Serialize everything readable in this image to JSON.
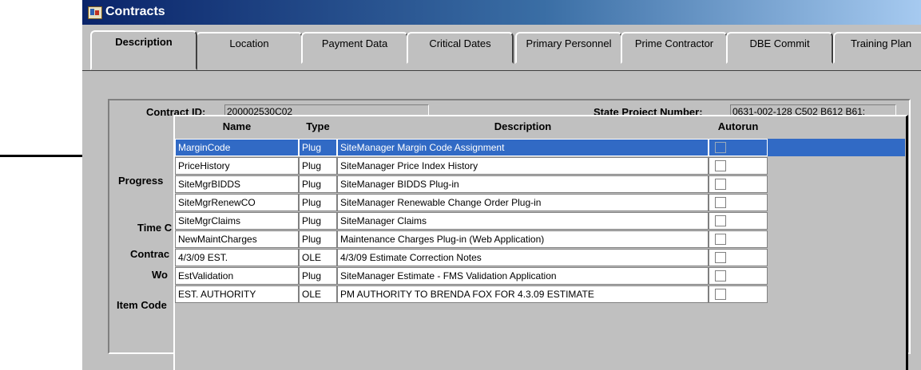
{
  "window": {
    "title": "Contracts"
  },
  "tabs": [
    {
      "label": "Description"
    },
    {
      "label": "Location"
    },
    {
      "label": "Payment Data"
    },
    {
      "label": "Critical Dates"
    },
    {
      "label": "Primary Personnel"
    },
    {
      "label": "Prime Contractor"
    },
    {
      "label": "DBE Commit"
    },
    {
      "label": "Training Plan"
    }
  ],
  "form": {
    "contract_id_label": "Contract ID:",
    "contract_id_value": "200002530C02",
    "state_project_label": "State Project Number:",
    "state_project_value": "0631-002-128 C502 B612 B61:",
    "progress_label": "Progress",
    "time_label": "Time C",
    "contract_label": "Contrac",
    "work_label": "Wo",
    "item_code_label": "Item Code"
  },
  "popup": {
    "columns": {
      "name": "Name",
      "type": "Type",
      "description": "Description",
      "autorun": "Autorun"
    },
    "rows": [
      {
        "name": "MarginCode",
        "type": "Plug",
        "description": "SiteManager Margin Code Assignment",
        "autorun": false,
        "selected": true
      },
      {
        "name": "PriceHistory",
        "type": "Plug",
        "description": "SiteManager Price Index History",
        "autorun": false
      },
      {
        "name": "SiteMgrBIDDS",
        "type": "Plug",
        "description": "SiteManager BIDDS Plug-in",
        "autorun": false
      },
      {
        "name": "SiteMgrRenewCO",
        "type": "Plug",
        "description": "SiteManager Renewable Change Order Plug-in",
        "autorun": false
      },
      {
        "name": "SiteMgrClaims",
        "type": "Plug",
        "description": "SiteManager Claims",
        "autorun": false
      },
      {
        "name": "NewMaintCharges",
        "type": "Plug",
        "description": "Maintenance Charges Plug-in (Web Application)",
        "autorun": false
      },
      {
        "name": "4/3/09 EST.",
        "type": "OLE",
        "description": "4/3/09 Estimate Correction Notes",
        "autorun": false
      },
      {
        "name": "EstValidation",
        "type": "Plug",
        "description": "SiteManager Estimate - FMS Validation Application",
        "autorun": false
      },
      {
        "name": "EST. AUTHORITY",
        "type": "OLE",
        "description": "PM AUTHORITY TO BRENDA FOX FOR 4.3.09 ESTIMATE",
        "autorun": false
      }
    ]
  },
  "colors": {
    "title_bar": "#0a246a",
    "selection": "#316ac5",
    "face": "#c0c0c0"
  },
  "icons": {
    "window": "contracts-app-icon",
    "pointer": "right-arrow-icon"
  }
}
